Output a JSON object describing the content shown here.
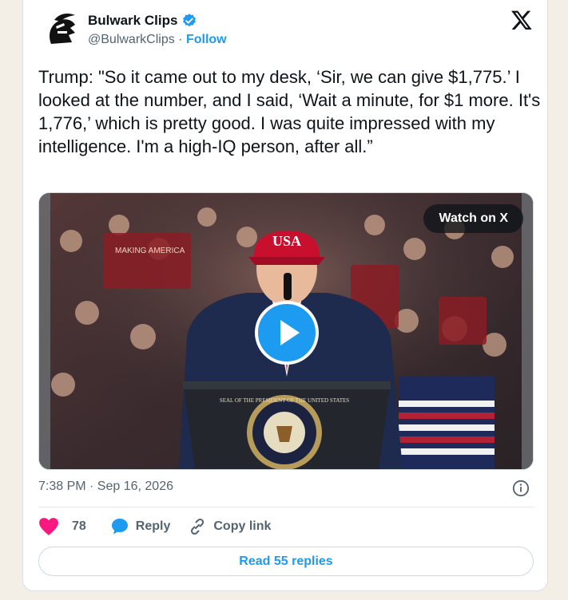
{
  "account": {
    "name": "Bulwark Clips",
    "handle": "@BulwarkClips",
    "separator": "·",
    "follow_label": "Follow"
  },
  "tweet": {
    "text": "Trump: \"So it came out to my desk, ‘Sir, we can give $1,775.’ I looked at the number, and I said, ‘Wait a minute, for $1 more. It's 1,776,’ which is pretty good. I was quite impressed with my intelligence. I'm a high-IQ person, after all.”",
    "timestamp": "7:38 PM · Sep 16, 2026"
  },
  "media": {
    "watch_label": "Watch on X",
    "cap_text": "USA",
    "banner_text": "MAKING AMERICA",
    "seal_text": "SEAL OF THE PRESIDENT OF THE UNITED STATES"
  },
  "actions": {
    "like_count": "78",
    "reply_label": "Reply",
    "copy_label": "Copy link"
  },
  "read_replies_label": "Read 55 replies",
  "icons": {
    "avatar": "trojan-helmet-logo",
    "verified": "verified-badge-icon",
    "brand": "x-logo-icon",
    "play": "play-icon",
    "info": "info-icon",
    "heart": "heart-icon",
    "reply": "reply-bubble-icon",
    "link": "link-icon"
  },
  "colors": {
    "accent": "#1d9bf0",
    "heart": "#f91880",
    "text": "#0f1419",
    "muted": "#536471"
  }
}
